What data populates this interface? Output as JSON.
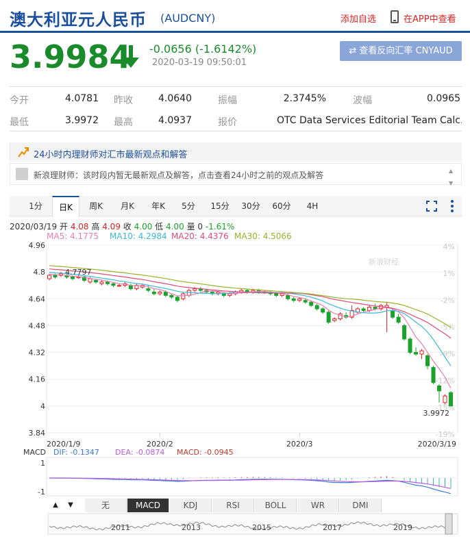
{
  "header": {
    "name": "澳大利亚元人民币",
    "code": "(AUDCNY)",
    "add_fav": "添加自选",
    "view_app": "在APP中查看"
  },
  "price": {
    "value": "3.9984",
    "change": "-0.0656 (-1.6142%)",
    "time": "2020-03-19 09:50:01",
    "reverse_btn": "⇄ 查看反向汇率 CNYAUD"
  },
  "quote": {
    "open_k": "今开",
    "open_v": "4.0781",
    "prev_k": "昨收",
    "prev_v": "4.0640",
    "amp_k": "振幅",
    "amp_v": "2.3745%",
    "wave_k": "波幅",
    "wave_v": "0.0965",
    "low_k": "最低",
    "low_v": "3.9972",
    "high_k": "最高",
    "high_v": "4.0937",
    "src_k": "报价",
    "src_v": "OTC Data Services Editorial Team Calc..."
  },
  "news": {
    "title": "24小时内理财师对汇市最新观点和解答",
    "line": "新浪理财师：该时段内暂无最新观点及解答，点击查看24小时之前的观点及解答"
  },
  "tabs": [
    "1分",
    "日K",
    "周K",
    "月K",
    "年K",
    "5分",
    "15分",
    "30分",
    "60分",
    "4H"
  ],
  "kinfo": {
    "date": "2020/03/19",
    "open_k": "开",
    "open_v": "4.08",
    "high_k": "高",
    "high_v": "4.09",
    "close_k": "收",
    "close_v": "4.00",
    "low_k": "低",
    "low_v": "4.00",
    "vol_k": "量",
    "vol_v": "0",
    "pct": "-1.61%"
  },
  "ma": {
    "ma5": "MA5: 4.1775",
    "ma10": "MA10: 4.2984",
    "ma20": "MA20: 4.4376",
    "ma30": "MA30: 4.5066"
  },
  "colors": {
    "up": "#e02020",
    "down": "#1aa32a",
    "brand": "#1a4f9c",
    "ma5": "#e87db1",
    "ma10": "#3bb8d8",
    "ma20": "#e04a78",
    "ma30": "#99b22a"
  },
  "chart_data": {
    "type": "candlestick",
    "y_ticks": [
      "4.96",
      "4.8",
      "4.64",
      "4.48",
      "4.32",
      "4.16",
      "4",
      "3.84"
    ],
    "y_range": [
      3.84,
      4.96
    ],
    "pct_ticks": [
      "4%",
      "1%",
      "-2%",
      "-5%",
      "-9%",
      "-12%",
      "-15%",
      "-19%"
    ],
    "x_labels": [
      "2020/1/9",
      "2020/2",
      "2020/3",
      "2020/3/19"
    ],
    "max_label": "4.7797",
    "min_label": "3.9972",
    "watermark": "新浪财经",
    "candles": [
      [
        4.76,
        4.78,
        4.79,
        4.75
      ],
      [
        4.78,
        4.77,
        4.79,
        4.76
      ],
      [
        4.78,
        4.79,
        4.8,
        4.77
      ],
      [
        4.78,
        4.77,
        4.79,
        4.76
      ],
      [
        4.77,
        4.76,
        4.78,
        4.75
      ],
      [
        4.77,
        4.77,
        4.78,
        4.76
      ],
      [
        4.77,
        4.75,
        4.78,
        4.74
      ],
      [
        4.74,
        4.76,
        4.77,
        4.73
      ],
      [
        4.75,
        4.74,
        4.76,
        4.73
      ],
      [
        4.73,
        4.74,
        4.75,
        4.72
      ],
      [
        4.74,
        4.73,
        4.75,
        4.72
      ],
      [
        4.73,
        4.72,
        4.74,
        4.71
      ],
      [
        4.72,
        4.72,
        4.73,
        4.71
      ],
      [
        4.72,
        4.73,
        4.74,
        4.71
      ],
      [
        4.72,
        4.7,
        4.73,
        4.69
      ],
      [
        4.7,
        4.72,
        4.73,
        4.69
      ],
      [
        4.71,
        4.72,
        4.73,
        4.7
      ],
      [
        4.7,
        4.69,
        4.72,
        4.68
      ],
      [
        4.68,
        4.67,
        4.7,
        4.66
      ],
      [
        4.67,
        4.68,
        4.69,
        4.66
      ],
      [
        4.68,
        4.66,
        4.69,
        4.65
      ],
      [
        4.66,
        4.65,
        4.67,
        4.64
      ],
      [
        4.65,
        4.63,
        4.66,
        4.62
      ],
      [
        4.64,
        4.67,
        4.68,
        4.63
      ],
      [
        4.66,
        4.69,
        4.7,
        4.65
      ],
      [
        4.69,
        4.7,
        4.71,
        4.68
      ],
      [
        4.7,
        4.69,
        4.71,
        4.68
      ],
      [
        4.69,
        4.68,
        4.7,
        4.67
      ],
      [
        4.68,
        4.67,
        4.69,
        4.66
      ],
      [
        4.67,
        4.68,
        4.69,
        4.66
      ],
      [
        4.67,
        4.66,
        4.68,
        4.65
      ],
      [
        4.66,
        4.67,
        4.68,
        4.65
      ],
      [
        4.67,
        4.68,
        4.69,
        4.66
      ],
      [
        4.68,
        4.69,
        4.7,
        4.67
      ],
      [
        4.69,
        4.68,
        4.7,
        4.67
      ],
      [
        4.68,
        4.69,
        4.7,
        4.67
      ],
      [
        4.69,
        4.68,
        4.7,
        4.67
      ],
      [
        4.68,
        4.68,
        4.69,
        4.67
      ],
      [
        4.68,
        4.67,
        4.69,
        4.66
      ],
      [
        4.67,
        4.66,
        4.68,
        4.65
      ],
      [
        4.66,
        4.67,
        4.68,
        4.65
      ],
      [
        4.66,
        4.64,
        4.67,
        4.63
      ],
      [
        4.64,
        4.63,
        4.65,
        4.62
      ],
      [
        4.63,
        4.64,
        4.65,
        4.62
      ],
      [
        4.63,
        4.62,
        4.64,
        4.61
      ],
      [
        4.62,
        4.6,
        4.63,
        4.59
      ],
      [
        4.6,
        4.58,
        4.61,
        4.57
      ],
      [
        4.58,
        4.56,
        4.59,
        4.55
      ],
      [
        4.56,
        4.5,
        4.57,
        4.49
      ],
      [
        4.51,
        4.52,
        4.53,
        4.5
      ],
      [
        4.52,
        4.55,
        4.56,
        4.51
      ],
      [
        4.54,
        4.53,
        4.56,
        4.52
      ],
      [
        4.53,
        4.57,
        4.6,
        4.52
      ],
      [
        4.56,
        4.58,
        4.59,
        4.55
      ],
      [
        4.58,
        4.57,
        4.59,
        4.56
      ],
      [
        4.57,
        4.59,
        4.6,
        4.56
      ],
      [
        4.59,
        4.58,
        4.61,
        4.57
      ],
      [
        4.58,
        4.6,
        4.61,
        4.57
      ],
      [
        4.59,
        4.6,
        4.62,
        4.44
      ],
      [
        4.57,
        4.53,
        4.58,
        4.52
      ],
      [
        4.53,
        4.5,
        4.55,
        4.49
      ],
      [
        4.48,
        4.4,
        4.49,
        4.39
      ],
      [
        4.4,
        4.32,
        4.41,
        4.31
      ],
      [
        4.32,
        4.31,
        4.35,
        4.3
      ],
      [
        4.31,
        4.33,
        4.34,
        4.28
      ],
      [
        4.3,
        4.24,
        4.31,
        4.22
      ],
      [
        4.23,
        4.14,
        4.24,
        4.13
      ],
      [
        4.12,
        4.09,
        4.13,
        4.02
      ],
      [
        4.02,
        4.06,
        4.07,
        4.01
      ],
      [
        4.08,
        4.0,
        4.09,
        4.0
      ]
    ],
    "macd_ticks": [
      "1",
      "-1"
    ],
    "macd_legend": {
      "title": "MACD",
      "dif": "DIF: -0.1347",
      "dea": "DEA: -0.0874",
      "macd": "MACD: -0.0945"
    },
    "macd_tabs": [
      "无",
      "MACD",
      "KDJ",
      "RSI",
      "BOLL",
      "WR",
      "DMI"
    ],
    "macd_active": "MACD",
    "nav_years": [
      "2011",
      "2013",
      "2015",
      "2017",
      "2019"
    ]
  }
}
